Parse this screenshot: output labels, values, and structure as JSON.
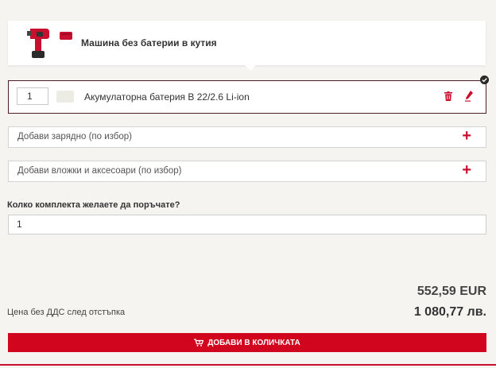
{
  "machine": {
    "title": "Машина без батерии в кутия",
    "thumbnail_icon": "impact-driver-with-case-image"
  },
  "battery": {
    "quantity": "1",
    "label": "Акумулаторна батерия B 22/2.6 Li-ion",
    "selected": true,
    "icons": [
      "battery-thumbnail",
      "trash-icon",
      "edit-icon",
      "check-icon"
    ]
  },
  "options": {
    "charger_label": "Добави зарядно (по избор)",
    "accessories_label": "Добави вложки и аксесоари (по избор)",
    "add_icon": "plus-icon"
  },
  "order": {
    "quantity_question": "Колко комплекта желаете да поръчате?",
    "quantity_value": "1"
  },
  "pricing": {
    "price_eur": "552,59 EUR",
    "price_bgn": "1 080,77 лв.",
    "note": "Цена без ДДС след отстъпка"
  },
  "cart": {
    "button_label": "ДОБАВИ В КОЛИЧКАТА",
    "icon": "cart-icon"
  },
  "colors": {
    "accent": "#d2051e",
    "selected_border": "#4a1e24",
    "background": "#f5f4f1"
  }
}
